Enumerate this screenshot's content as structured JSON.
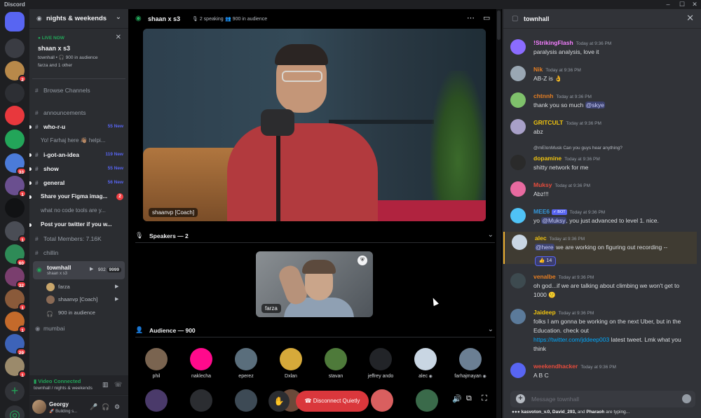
{
  "window": {
    "app_name": "Discord",
    "minimize": "–",
    "maximize": "☐",
    "close": "✕"
  },
  "servers": [
    {
      "color": "#5865f2",
      "badge": ""
    },
    {
      "color": "#3a3c43",
      "badge": ""
    },
    {
      "color": "#b8894a",
      "badge": "2"
    },
    {
      "color": "#2d2f34",
      "badge": ""
    },
    {
      "color": "#e8383d",
      "badge": ""
    },
    {
      "color": "#23a559",
      "badge": ""
    },
    {
      "color": "#4b7bd9",
      "badge": "33"
    },
    {
      "color": "#6a4f8f",
      "badge": "1"
    },
    {
      "color": "#111214",
      "badge": ""
    },
    {
      "color": "#4a4d55",
      "badge": "1"
    },
    {
      "color": "#2e8b57",
      "badge": "60"
    },
    {
      "color": "#7a3e6e",
      "badge": "32"
    },
    {
      "color": "#8a5a3a",
      "badge": "1"
    },
    {
      "color": "#c46a2b",
      "badge": "1"
    },
    {
      "color": "#3d63b8",
      "badge": "29"
    },
    {
      "color": "#9b8a6b",
      "badge": "1"
    }
  ],
  "server": {
    "name": "nights & weekends"
  },
  "live_card": {
    "live_label": "LIVE NOW",
    "title": "shaan x s3",
    "meta": "townhall • 🎧 900 in audience",
    "who": "farza and 1 other"
  },
  "browse": "Browse Channels",
  "channels": [
    {
      "label": "announcements",
      "style": "",
      "badge": ""
    },
    {
      "label": "who-r-u",
      "style": "unread",
      "badge": "55 New"
    },
    {
      "label": "Yo! Farhaj here 👋🏽 helpi...",
      "style": "sub",
      "badge": ""
    },
    {
      "label": "i-got-an-idea",
      "style": "unread",
      "badge": "119 New"
    },
    {
      "label": "show",
      "style": "unread",
      "badge": "55 New"
    },
    {
      "label": "general",
      "style": "unread",
      "badge": "56 New"
    },
    {
      "label": "Share your Figma imag...",
      "style": "subunread",
      "badge": "2"
    },
    {
      "label": "what no code tools are y...",
      "style": "sub",
      "badge": ""
    },
    {
      "label": "Post your twitter if you w...",
      "style": "subunread",
      "badge": ""
    },
    {
      "label": "Total Members: 7.16K",
      "style": "",
      "badge": ""
    },
    {
      "label": "chillin",
      "style": "",
      "badge": ""
    }
  ],
  "active_channel": {
    "name": "townhall",
    "sub": "shaan x s3",
    "count_a": "902",
    "count_b": "9999"
  },
  "voice_users": [
    {
      "name": "farza",
      "color": "#c9a66b"
    },
    {
      "name": "shaanvp [Coach]",
      "color": "#8a6a55"
    },
    {
      "name": "900 in audience",
      "color": ""
    }
  ],
  "after_channel": "mumbai",
  "voice_connected": {
    "title": "Video Connected",
    "sub": "townhall / nights & weekends"
  },
  "user": {
    "name": "Georgy",
    "status": "🚀 Building s..."
  },
  "stage": {
    "title": "shaan x s3",
    "speaking": "2 speaking",
    "audience": "900 in audience",
    "main_label": "shaanvp [Coach]",
    "speakers_header": "Speakers — 2",
    "speaker_label": "farza",
    "audience_header": "Audience — 900",
    "audience_list": [
      {
        "name": "phil",
        "color": "#7a6450",
        "mod": false
      },
      {
        "name": "naklecha",
        "color": "#ff0a8c",
        "mod": false
      },
      {
        "name": "eperez",
        "color": "#5a6e7c",
        "mod": false
      },
      {
        "name": "Dxlan",
        "color": "#d6a93a",
        "mod": false
      },
      {
        "name": "stavan",
        "color": "#4e7a3a",
        "mod": false
      },
      {
        "name": "jeffrey ando",
        "color": "#222428",
        "mod": false
      },
      {
        "name": "alec",
        "color": "#c9d6e3",
        "mod": true
      },
      {
        "name": "farhajmayan",
        "color": "#6b7f93",
        "mod": true
      }
    ],
    "disconnect_label": "Disconnect Quietly"
  },
  "chat": {
    "title": "townhall",
    "messages": [
      {
        "user": "!StrikingFlash",
        "color": "#f47fff",
        "time": "Today at 9:36 PM",
        "text": "paralysis analysis, love it",
        "avatar": "#8b6cff"
      },
      {
        "user": "Nik",
        "color": "#e67e22",
        "time": "Today at 9:36 PM",
        "text": "AB-Z is 👌",
        "avatar": "#9aa7b3"
      },
      {
        "user": "chtnnh",
        "color": "#e67e22",
        "time": "Today at 9:36 PM",
        "text": "thank you so much",
        "mention": "@skye",
        "avatar": "#7fc16b"
      },
      {
        "user": "GRITCULT",
        "color": "#f1c40f",
        "time": "Today at 9:36 PM",
        "text": "abz",
        "avatar": "#a8a0c8"
      },
      {
        "user": "dopamine",
        "color": "#f1c40f",
        "time": "Today at 9:36 PM",
        "text": "shitty network for me",
        "reply": "@mElonMusk Can you guys hear anything?",
        "avatar": "#2a2a2a"
      },
      {
        "user": "Muksy",
        "color": "#e74c3c",
        "time": "Today at 9:36 PM",
        "text": "Abz!!!",
        "avatar": "#e86aa0"
      },
      {
        "user": "MEE6",
        "color": "#3498db",
        "time": "Today at 9:36 PM",
        "text_pre": "yo",
        "mention": "@Muksy",
        "text": ", you just advanced to level 1. nice.",
        "bot": "✓ BOT",
        "avatar": "#4fc3f7"
      },
      {
        "user": "alec",
        "color": "#f1c40f",
        "time": "Today at 9:36 PM",
        "mention": "@here",
        "text": " we are working on figuring out recording --",
        "reaction": "👍 14",
        "avatar": "#c9d6e3"
      },
      {
        "user": "venalbe",
        "color": "#e67e22",
        "time": "Today at 9:36 PM",
        "text": "oh god...if we are talking about climbing we won't get to 1000 🙂",
        "avatar": "#3d4a4f"
      },
      {
        "user": "Jaideep",
        "color": "#f1c40f",
        "time": "Today at 9:36 PM",
        "text": "folks I am gonna be working on the next Uber, but in the Education. check out",
        "link": "https://twitter.com/jddeep003",
        "text_post": " latest tweet. Lmk what you think",
        "avatar": "#5b7a9a"
      },
      {
        "user": "weekendhacker",
        "color": "#e74c3c",
        "time": "Today at 9:36 PM",
        "text": "A B C",
        "avatar": "#5865f2"
      }
    ],
    "input_placeholder": "Message townhall",
    "typing_users": "kasvoton_v.0, David_293,",
    "typing_and": " and ",
    "typing_last": "Pharaoh",
    "typing_suffix": " are typing..."
  }
}
